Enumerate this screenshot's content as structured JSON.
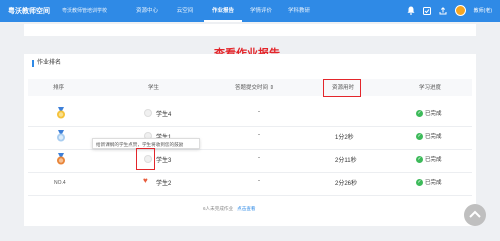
{
  "header": {
    "brand": "粤沃教师空间",
    "school": "粤沃教师管培训学校",
    "nav": [
      {
        "label": "资源中心",
        "active": false
      },
      {
        "label": "云空间",
        "active": false
      },
      {
        "label": "作业报告",
        "active": true
      },
      {
        "label": "学情评价",
        "active": false
      },
      {
        "label": "学科教研",
        "active": false
      }
    ],
    "user_name": "教师(老)"
  },
  "annotation": "查看作业报告",
  "section_title": "作业排名",
  "table": {
    "headers": [
      "排序",
      "学生",
      "答题提交时间",
      "资源用时",
      "学习进度"
    ],
    "rows": [
      {
        "rank": "",
        "student": "学生4",
        "submit_time": "-",
        "duration": "",
        "status": "已完成"
      },
      {
        "rank": "",
        "student": "学生1",
        "submit_time": "-",
        "duration": "1分2秒",
        "status": "已完成"
      },
      {
        "rank": "",
        "student": "学生3",
        "submit_time": "-",
        "duration": "2分11秒",
        "status": "已完成"
      },
      {
        "rank": "NO.4",
        "student": "学生2",
        "submit_time": "-",
        "duration": "2分26秒",
        "status": "已完成"
      }
    ]
  },
  "tooltip": "给新课纲的学生点赞，学生将收到您的鼓励",
  "footer": {
    "text": "6人未完成作业",
    "link": "点击查看"
  },
  "colors": {
    "primary": "#2f8ae6",
    "annotation_red": "#e3262b",
    "success": "#3dba5a",
    "gold": "#f5a623",
    "silver": "#a9cdf0",
    "bronze": "#e8853a"
  }
}
